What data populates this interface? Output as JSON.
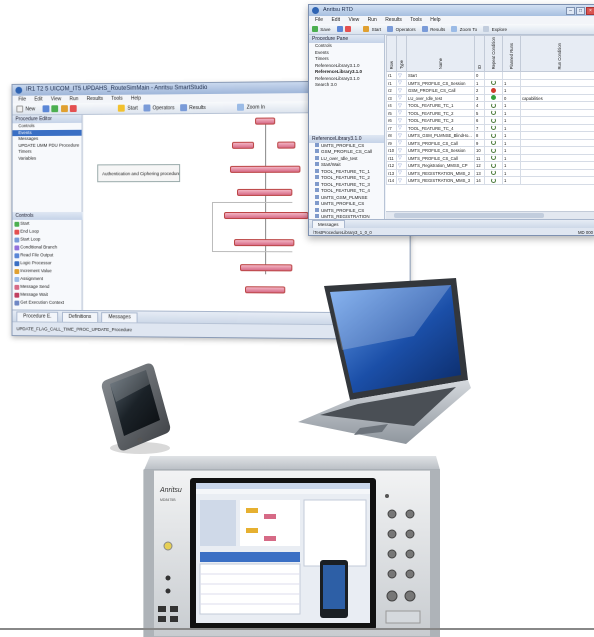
{
  "back_window": {
    "title": "IR1 T2 5 UICOM_IT5 UPDAHS_RouteSimMain - Anritsu SmartStudio",
    "menu": [
      "File",
      "Edit",
      "View",
      "Run",
      "Results",
      "Tools",
      "Help"
    ],
    "toolbar": {
      "new_label": "New",
      "start_label": "Start",
      "operators_label": "Operators",
      "results_label": "Results",
      "zoom_label": "Zoom In"
    },
    "procedure_pane_title": "Procedure Editor",
    "procedure_items": [
      "Controls",
      "Events",
      "Messages",
      "UPDATE UMM PDU Procedure",
      "Timers",
      "Variables"
    ],
    "controls_title": "Controls",
    "controls_items": [
      "Start",
      "End Loop",
      "Start Loop",
      "Conditional Branch",
      "Read File Output",
      "Logic Processor",
      "Increment Value",
      "Assignment",
      "Message Send",
      "Message Wait",
      "Get Execution Context"
    ],
    "note_text": "Authentication and Ciphering procedure",
    "bottom_tabs": [
      "Procedure E.",
      "Definitions"
    ],
    "messages_tab": "Messages",
    "status_left": "UPDATE_FLAG_CALL_TIME_PROC_UPDATE_Procedure",
    "status_right": "100%"
  },
  "front_window": {
    "title": "Anritsu RTD",
    "menu": [
      "File",
      "Edit",
      "View",
      "Run",
      "Results",
      "Tools",
      "Help"
    ],
    "toolbar": {
      "save_label": "Save",
      "start_label": "Start",
      "operators_label": "Operators",
      "results_label": "Results",
      "zoom_label": "Zoom To",
      "explore_label": "Explore"
    },
    "procedure_pane_title": "Procedure Pane",
    "procedure_items": [
      "Controls",
      "Events",
      "Timers",
      "ReferenceLibrary3.1.0",
      "ReferenceLibrary3.1.0",
      "ReferenceLibrary3.1.0",
      "Search 3.0"
    ],
    "library_title": "ReferenceLibrary3.1.0",
    "library_items": [
      "UMTS_PROFILE_CS",
      "GSM_PROFILE_CS_Call",
      "LU_over_Idle_test",
      "Start/Wait",
      "TOOL_FEATURE_TC_1",
      "TOOL_FEATURE_TC_2",
      "TOOL_FEATURE_TC_3",
      "TOOL_FEATURE_TC_4",
      "UMTS_GSM_PLMNSE",
      "UMTS_PROFILE_CS",
      "UMTS_PROFILE_CS",
      "UMTS_REGISTRATION"
    ],
    "table_headers": [
      "Row",
      "Type",
      "Name",
      "ID",
      "Repeat Condition",
      "Planned Runs",
      "Run Condition"
    ],
    "rows": [
      {
        "row": "r1",
        "name": "Start",
        "id": "0",
        "result": "none",
        "planned": "",
        "condition": ""
      },
      {
        "row": "r1",
        "name": "UMTS_PROFILE_CS_Session",
        "id": "1",
        "result": "loop",
        "planned": "1",
        "condition": ""
      },
      {
        "row": "r2",
        "name": "GSM_PROFILE_CS_Call",
        "id": "2",
        "result": "fail",
        "planned": "1",
        "condition": ""
      },
      {
        "row": "r3",
        "name": "LU_over_Idle_test",
        "id": "3",
        "result": "pass",
        "planned": "0",
        "condition": "capabilities"
      },
      {
        "row": "r4",
        "name": "TOOL_FEATURE_TC_1",
        "id": "4",
        "result": "loop",
        "planned": "1",
        "condition": ""
      },
      {
        "row": "r5",
        "name": "TOOL_FEATURE_TC_2",
        "id": "5",
        "result": "loop",
        "planned": "1",
        "condition": ""
      },
      {
        "row": "r6",
        "name": "TOOL_FEATURE_TC_3",
        "id": "6",
        "result": "loop",
        "planned": "1",
        "condition": ""
      },
      {
        "row": "r7",
        "name": "TOOL_FEATURE_TC_4",
        "id": "7",
        "result": "loop",
        "planned": "1",
        "condition": ""
      },
      {
        "row": "r8",
        "name": "UMTS_GSM_PLMNSE_BlindHo...",
        "id": "8",
        "result": "loop",
        "planned": "1",
        "condition": ""
      },
      {
        "row": "r9",
        "name": "UMTS_PROFILE_CS_Call",
        "id": "9",
        "result": "loop",
        "planned": "1",
        "condition": ""
      },
      {
        "row": "r10",
        "name": "UMTS_PROFILE_CS_Session",
        "id": "10",
        "result": "loop",
        "planned": "1",
        "condition": ""
      },
      {
        "row": "r11",
        "name": "UMTS_PROFILE_CS_Call",
        "id": "11",
        "result": "loop",
        "planned": "1",
        "condition": ""
      },
      {
        "row": "r12",
        "name": "UMTS_Registration_MMSS_CP",
        "id": "12",
        "result": "loop",
        "planned": "1",
        "condition": ""
      },
      {
        "row": "r13",
        "name": "UMTS_REGISTRATION_MMS_2",
        "id": "13",
        "result": "loop",
        "planned": "1",
        "condition": ""
      },
      {
        "row": "r14",
        "name": "UMTS_REGISTRATION_MMS_3",
        "id": "14",
        "result": "loop",
        "planned": "1",
        "condition": ""
      }
    ],
    "messages_tab": "Messages",
    "status_left": "\\TestProcedureLibrary3_1_0_0",
    "status_right": "MD 000"
  },
  "analyzer": {
    "brand": "Anritsu",
    "model": "MD8475B"
  },
  "colors": {
    "flow_node": "#d66a86",
    "selection": "#3a6fc4",
    "pass": "#36a23d",
    "fail": "#d23b2b"
  }
}
